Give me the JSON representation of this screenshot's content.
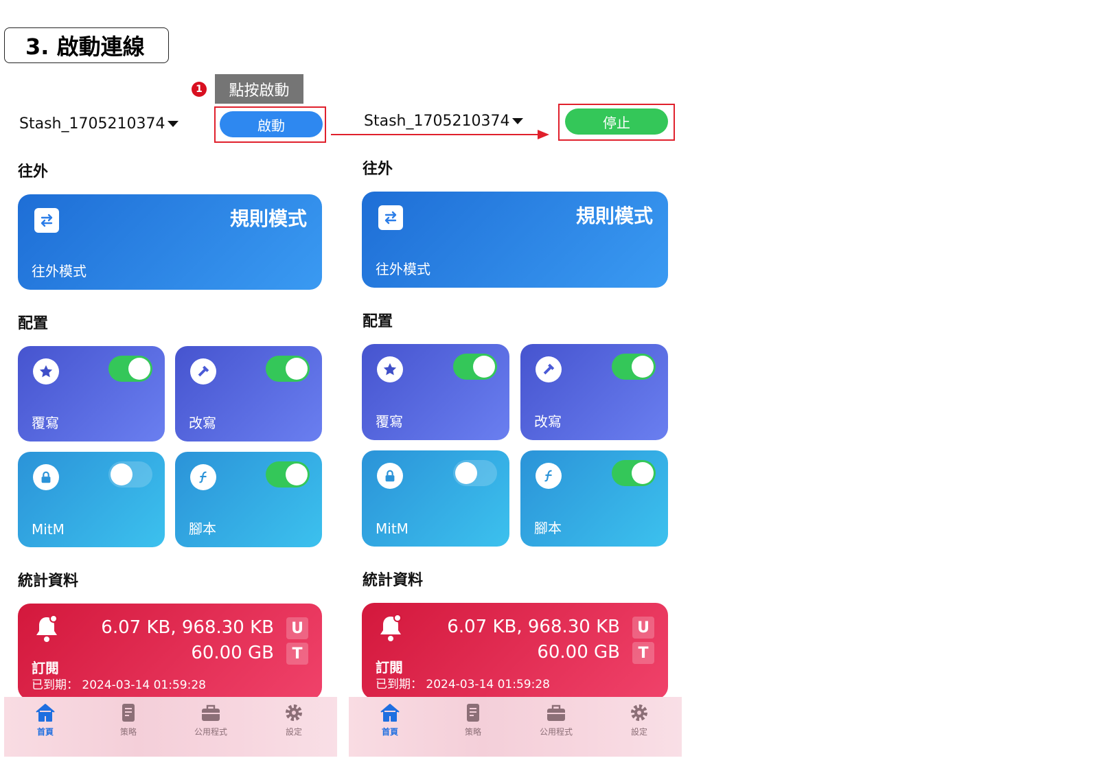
{
  "step": {
    "title": "3. 啟動連線",
    "badge": "1",
    "tooltip": "點按啟動"
  },
  "colors": {
    "start": "#2e88f0",
    "stop": "#34c759",
    "highlight": "#e0202c",
    "active_tab": "#1f6fe0"
  },
  "phones": [
    {
      "profile": "Stash_1705210374",
      "action_button": "啟動",
      "outbound": {
        "section": "往外",
        "mode_title": "規則模式",
        "mode_label": "往外模式",
        "icon": "swap-icon"
      },
      "config": {
        "section": "配置",
        "tiles": [
          {
            "label": "覆寫",
            "icon": "star-icon",
            "enabled": true
          },
          {
            "label": "改寫",
            "icon": "hammer-icon",
            "enabled": true
          },
          {
            "label": "MitM",
            "icon": "lock-icon",
            "enabled": false
          },
          {
            "label": "腳本",
            "icon": "script-icon",
            "enabled": true
          }
        ]
      },
      "stats": {
        "section": "統計資料",
        "usage": "6.07 KB, 968.30 KB",
        "usage_badge": "U",
        "total": "60.00 GB",
        "total_badge": "T",
        "name": "訂閱",
        "expire": "已到期： 2024-03-14 01:59:28"
      },
      "tabs": [
        {
          "label": "首頁",
          "icon": "home-icon",
          "active": true
        },
        {
          "label": "策略",
          "icon": "document-icon",
          "active": false
        },
        {
          "label": "公用程式",
          "icon": "toolbox-icon",
          "active": false
        },
        {
          "label": "設定",
          "icon": "gear-icon",
          "active": false
        }
      ]
    },
    {
      "profile": "Stash_1705210374",
      "action_button": "停止",
      "outbound": {
        "section": "往外",
        "mode_title": "規則模式",
        "mode_label": "往外模式",
        "icon": "swap-icon"
      },
      "config": {
        "section": "配置",
        "tiles": [
          {
            "label": "覆寫",
            "icon": "star-icon",
            "enabled": true
          },
          {
            "label": "改寫",
            "icon": "hammer-icon",
            "enabled": true
          },
          {
            "label": "MitM",
            "icon": "lock-icon",
            "enabled": false
          },
          {
            "label": "腳本",
            "icon": "script-icon",
            "enabled": true
          }
        ]
      },
      "stats": {
        "section": "統計資料",
        "usage": "6.07 KB, 968.30 KB",
        "usage_badge": "U",
        "total": "60.00 GB",
        "total_badge": "T",
        "name": "訂閱",
        "expire": "已到期： 2024-03-14 01:59:28"
      },
      "tabs": [
        {
          "label": "首頁",
          "icon": "home-icon",
          "active": true
        },
        {
          "label": "策略",
          "icon": "document-icon",
          "active": false
        },
        {
          "label": "公用程式",
          "icon": "toolbox-icon",
          "active": false
        },
        {
          "label": "設定",
          "icon": "gear-icon",
          "active": false
        }
      ]
    }
  ]
}
